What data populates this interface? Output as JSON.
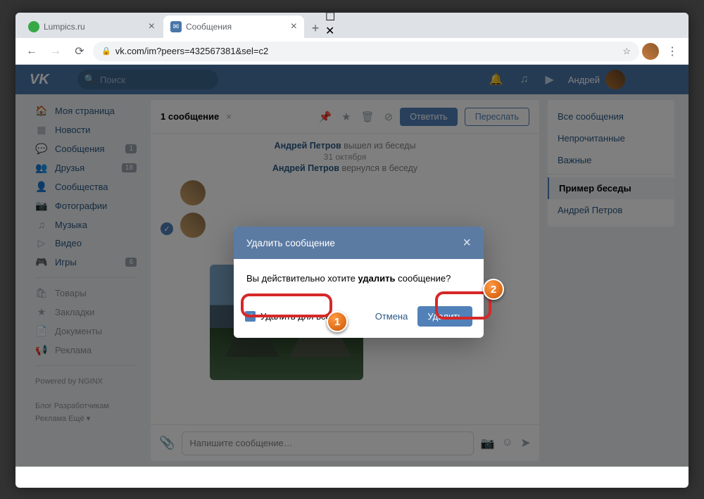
{
  "tabs": {
    "tab1": "Lumpics.ru",
    "tab2": "Сообщения"
  },
  "url": "vk.com/im?peers=432567381&sel=c2",
  "search": "Поиск",
  "user": "Андрей",
  "sidebar": [
    {
      "ic": "🏠",
      "label": "Моя страница"
    },
    {
      "ic": "▦",
      "label": "Новости"
    },
    {
      "ic": "💬",
      "label": "Сообщения",
      "badge": "1"
    },
    {
      "ic": "👥",
      "label": "Друзья",
      "badge": "18"
    },
    {
      "ic": "👤",
      "label": "Сообщества"
    },
    {
      "ic": "📷",
      "label": "Фотографии"
    },
    {
      "ic": "♫",
      "label": "Музыка"
    },
    {
      "ic": "▷",
      "label": "Видео"
    },
    {
      "ic": "🎮",
      "label": "Игры",
      "badge": "6"
    }
  ],
  "sidebar2": [
    {
      "ic": "🛍",
      "label": "Товары"
    },
    {
      "ic": "★",
      "label": "Закладки"
    },
    {
      "ic": "📄",
      "label": "Документы"
    },
    {
      "ic": "📢",
      "label": "Реклама"
    }
  ],
  "footer": {
    "powered": "Powered by NGINX",
    "l1": "Блог  Разработчикам",
    "l2": "Реклама  Ещё ▾"
  },
  "chat": {
    "selected": "1 сообщение",
    "reply": "Ответить",
    "forward": "Переслать",
    "sys1_name": "Андрей Петров",
    "sys1_act": " вышел из беседы",
    "date": "31 октября",
    "sys2_name": "Андрей Петров",
    "sys2_act": " вернулся в беседу",
    "ph": "Напишите сообщение…"
  },
  "filters": {
    "all": "Все сообщения",
    "unread": "Непрочитанные",
    "important": "Важные",
    "conv": "Пример беседы",
    "person": "Андрей Петров"
  },
  "modal": {
    "title": "Удалить сообщение",
    "q1": "Вы действительно хотите ",
    "q2": "удалить",
    "q3": " сообщение?",
    "chk": "Удалить для всех",
    "cancel": "Отмена",
    "del": "Удалить"
  },
  "ann": {
    "n1": "1",
    "n2": "2"
  }
}
